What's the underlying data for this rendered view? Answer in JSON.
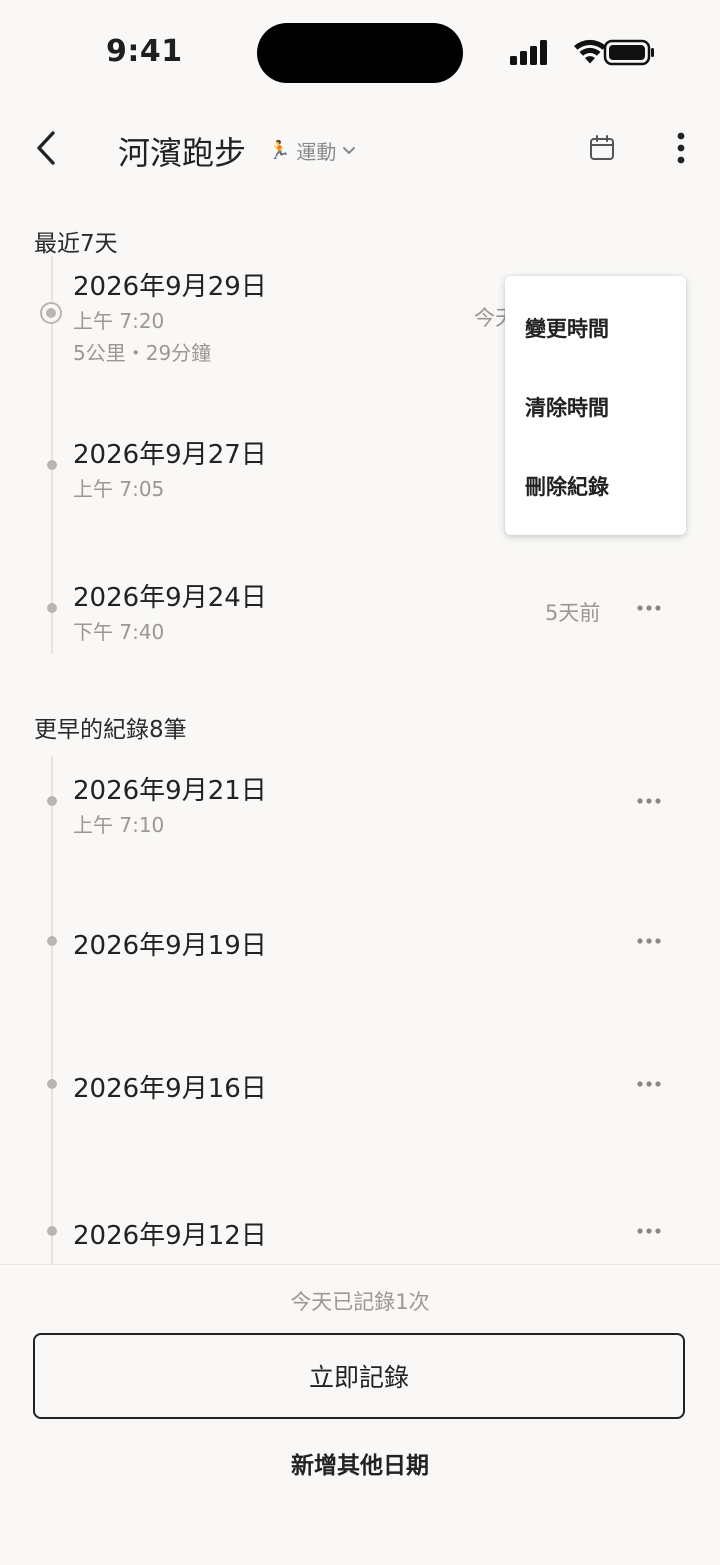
{
  "status_bar": {
    "time": "9:41"
  },
  "header": {
    "title": "河濱跑步",
    "category_icon": "🏃",
    "category": "運動"
  },
  "recent_section": {
    "title": "最近7天",
    "entries": [
      {
        "date": "2026年9月29日",
        "time": "上午 7:20",
        "detail": "5公里・29分鐘",
        "relative": "今天"
      },
      {
        "date": "2026年9月27日",
        "time": "上午 7:05"
      },
      {
        "date": "2026年9月24日",
        "time": "下午 7:40",
        "relative": "5天前"
      }
    ]
  },
  "earlier_section": {
    "title": "更早的紀錄8筆",
    "entries": [
      {
        "date": "2026年9月21日",
        "time": "上午 7:10"
      },
      {
        "date": "2026年9月19日"
      },
      {
        "date": "2026年9月16日"
      },
      {
        "date": "2026年9月12日"
      }
    ]
  },
  "context_menu": {
    "items": [
      "變更時間",
      "清除時間",
      "刪除紀錄"
    ]
  },
  "footer": {
    "today_count": "今天已記錄1次",
    "record_now": "立即記錄",
    "add_other_date": "新增其他日期"
  }
}
